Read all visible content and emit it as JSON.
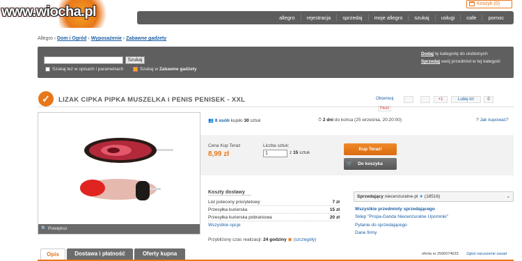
{
  "header": {
    "logo": "www.wiocha.pl",
    "cart": "Koszyk (0)",
    "nav": [
      "allegro",
      "rejestracja",
      "sprzedaj",
      "moje allegro",
      "szukaj",
      "usługi",
      "cafe",
      "pomoc"
    ]
  },
  "breadcrumb": {
    "root": "Allegro",
    "sep": "›",
    "items": [
      "Dom i Ogród",
      "Wyposażenie",
      "Zabawne gadżety"
    ]
  },
  "search": {
    "placeholder": "",
    "button": "Szukaj",
    "option1": "Szukaj też w opisach i parametrach",
    "option2_prefix": "Szukaj w",
    "option2_cat": "Zabawne gadżety",
    "right_line1_link": "Dodaj",
    "right_line1_text": "tę kategorię do ulubionych",
    "right_line2_link": "Sprzedaj",
    "right_line2_text": "swój przedmiot w tej kategorii"
  },
  "product": {
    "title": "LIZAK CIPKA PIPKA MUSZELKA i PENIS PENISEK - XXL",
    "observe": "Obserwuj",
    "flag": "Pleść",
    "gplus": "+1",
    "like": "Lubię to!",
    "like_count": "0",
    "buyers_link": "8 osób",
    "buyers_text": "kupiło",
    "buyers_count": "30",
    "buyers_unit": "sztuk",
    "time_bold": "2 dni",
    "time_text": "do końca (25 września, 20:20:00)",
    "how_buy": "Jak kupować?",
    "zoom": "Powiększ"
  },
  "buy": {
    "price_label": "Cena Kup Teraz",
    "price": "8,99 zł",
    "qty_label": "Liczba sztuk:",
    "qty_value": "1",
    "qty_of": "z",
    "qty_max": "15",
    "qty_unit": "sztuk",
    "buy_now": "Kup Teraz!",
    "to_cart": "Do koszyka"
  },
  "shipping": {
    "heading": "Koszty dostawy",
    "rows": [
      {
        "label": "List polecony priorytetowy",
        "value": "7 zł"
      },
      {
        "label": "Przesyłka kurierska",
        "value": "15 zł"
      },
      {
        "label": "Przesyłka kurierska pobraniowa",
        "value": "20 zł"
      }
    ],
    "all": "Wszystkie opcje",
    "time_label": "Przybliżony czas realizacji:",
    "time_value": "24 godziny",
    "details": "(szczegóły)"
  },
  "seller": {
    "label": "Sprzedający",
    "name": "niecenzuralne-pl",
    "rating": "(18516)",
    "links": [
      "Wszystkie przedmioty sprzedającego",
      "Sklep \"Propa-Ganda Niecenzuralne Upominki\"",
      "Pytanie do sprzedającego",
      "Dane firmy"
    ]
  },
  "tabs": [
    "Opis",
    "Dostawa i płatność",
    "Oferty kupna"
  ],
  "footer": {
    "offer": "oferta nr 2590074633",
    "report": "Zgłoś naruszenie zasad"
  }
}
